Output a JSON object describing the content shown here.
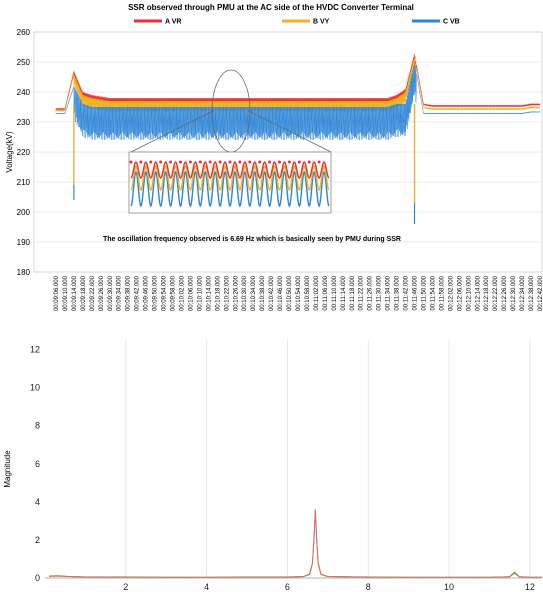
{
  "chart_data": [
    {
      "type": "line",
      "title": "SSR observed through PMU at the AC side of the HVDC Converter Terminal",
      "ylabel": "Voltage(kV)",
      "xlabel": "",
      "ylim": [
        180,
        260
      ],
      "yticks": [
        180,
        190,
        200,
        210,
        220,
        230,
        240,
        250,
        260
      ],
      "grid": "horizontal",
      "legend_position": "top",
      "x": [
        "00:09:06.000",
        "00:09:10.000",
        "00:09:14.000",
        "00:09:18.000",
        "00:09:22.000",
        "00:09:26.000",
        "00:09:30.000",
        "00:09:34.000",
        "00:09:38.000",
        "00:09:42.000",
        "00:09:46.000",
        "00:09:50.000",
        "00:09:54.000",
        "00:09:58.000",
        "00:10:02.000",
        "00:10:06.000",
        "00:10:10.000",
        "00:10:14.000",
        "00:10:18.000",
        "00:10:22.000",
        "00:10:26.000",
        "00:10:30.000",
        "00:10:34.000",
        "00:10:38.000",
        "00:10:42.000",
        "00:10:46.000",
        "00:10:50.000",
        "00:10:54.000",
        "00:10:58.000",
        "00:11:02.000",
        "00:11:06.000",
        "00:11:10.000",
        "00:11:14.000",
        "00:11:18.000",
        "00:11:22.000",
        "00:11:26.000",
        "00:11:30.000",
        "00:11:34.000",
        "00:11:38.000",
        "00:11:42.000",
        "00:11:46.000",
        "00:11:50.000",
        "00:11:54.000",
        "00:11:58.000",
        "00:12:02.000",
        "00:12:06.000",
        "00:12:10.000",
        "00:12:14.000",
        "00:12:18.000",
        "00:12:22.000",
        "00:12:26.000",
        "00:12:30.000",
        "00:12:34.000",
        "00:12:38.000",
        "00:12:42.000"
      ],
      "series": [
        {
          "name": "A VR",
          "color": "#e8303a",
          "values": [
            234.5,
            234.5,
            247,
            240,
            239,
            238.5,
            238,
            238,
            238,
            238,
            238,
            238,
            238,
            238,
            238,
            238,
            238,
            238,
            238,
            238,
            238,
            238,
            238,
            238,
            238,
            238,
            238,
            238,
            238,
            238,
            238,
            238,
            238,
            238,
            238,
            238,
            238,
            238,
            239,
            241,
            253,
            236,
            235.5,
            235.5,
            235.5,
            235.5,
            235.5,
            235.5,
            235.5,
            235.5,
            235.5,
            235.5,
            235.5,
            236,
            236
          ]
        },
        {
          "name": "B VY",
          "color": "#f2b320",
          "values": [
            234,
            234,
            246,
            239,
            238,
            237.5,
            237,
            237,
            237,
            237,
            237,
            237,
            237,
            237,
            237,
            237,
            237,
            237,
            237,
            237,
            237,
            237,
            237,
            237,
            237,
            237,
            237,
            237,
            237,
            237,
            237,
            237,
            237,
            237,
            237,
            237,
            237,
            237,
            238,
            240,
            252,
            235,
            234.5,
            234.5,
            234.5,
            234.5,
            234.5,
            234.5,
            234.5,
            234.5,
            234.5,
            234.5,
            234.5,
            235,
            235
          ]
        },
        {
          "name": "C VB",
          "color": "#2f86d6",
          "values": [
            233,
            233,
            242,
            236,
            235,
            235,
            235,
            235,
            235,
            235,
            235,
            235,
            235,
            235,
            235,
            235,
            235,
            235,
            235,
            235,
            235,
            235,
            235,
            235,
            235,
            235,
            235,
            235,
            235,
            235,
            235,
            235,
            235,
            235,
            235,
            235,
            235,
            235,
            236,
            236,
            250,
            233,
            233,
            233,
            233,
            233,
            233,
            233,
            233,
            233,
            233,
            233,
            233,
            233.5,
            233.5
          ]
        }
      ],
      "annotation": "The oscillation frequency observed is  6.69 Hz  which is basically seen by PMU during SSR"
    },
    {
      "type": "line",
      "title": "",
      "ylabel": "Magnitude",
      "xlabel": "",
      "xlim": [
        0,
        12.3
      ],
      "ylim": [
        0,
        12.5
      ],
      "xticks": [
        2,
        4,
        6,
        8,
        10,
        12
      ],
      "yticks": [
        0,
        2,
        4,
        6,
        8,
        10,
        12
      ],
      "grid": "vertical",
      "series": [
        {
          "name": "",
          "color": "#2e9e4a",
          "x": [
            0.1,
            0.3,
            0.6,
            1.0,
            2.0,
            3.0,
            4.0,
            5.0,
            6.0,
            6.4,
            6.55,
            6.62,
            6.66,
            6.69,
            6.72,
            6.76,
            6.83,
            7.0,
            8.0,
            9.0,
            10.0,
            11.0,
            11.5,
            11.62,
            11.74,
            12.0,
            12.3
          ],
          "y": [
            0.1,
            0.12,
            0.08,
            0.06,
            0.05,
            0.04,
            0.04,
            0.05,
            0.05,
            0.08,
            0.2,
            0.8,
            2.2,
            3.6,
            2.2,
            0.8,
            0.2,
            0.08,
            0.05,
            0.04,
            0.04,
            0.04,
            0.07,
            0.3,
            0.07,
            0.04,
            0.04
          ]
        },
        {
          "name": "",
          "color": "#e36b6b",
          "x": [
            0.1,
            0.3,
            0.6,
            1.0,
            2.0,
            3.0,
            4.0,
            5.0,
            6.0,
            6.4,
            6.55,
            6.62,
            6.66,
            6.69,
            6.72,
            6.76,
            6.83,
            7.0,
            8.0,
            9.0,
            10.0,
            11.0,
            11.5,
            11.62,
            11.74,
            12.0,
            12.3
          ],
          "y": [
            0.08,
            0.1,
            0.07,
            0.05,
            0.04,
            0.04,
            0.03,
            0.04,
            0.04,
            0.07,
            0.18,
            0.75,
            2.1,
            3.55,
            2.1,
            0.75,
            0.18,
            0.07,
            0.04,
            0.03,
            0.03,
            0.03,
            0.06,
            0.25,
            0.06,
            0.03,
            0.03
          ]
        }
      ]
    }
  ]
}
